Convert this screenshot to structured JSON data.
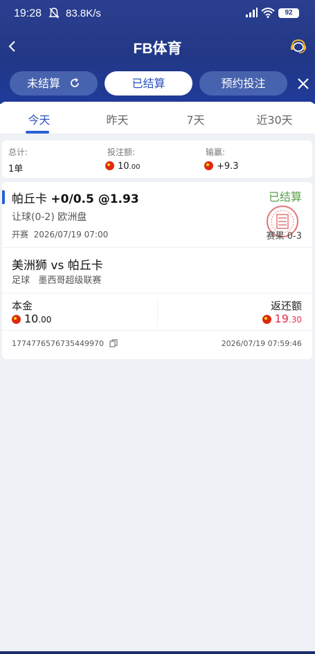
{
  "status_bar": {
    "time": "19:28",
    "net_speed": "83.8K/s",
    "battery": "92"
  },
  "header": {
    "title": "FB体育"
  },
  "filter_tabs": [
    {
      "label": "未结算",
      "active": false
    },
    {
      "label": "已结算",
      "active": true
    },
    {
      "label": "预约投注",
      "active": false
    }
  ],
  "date_tabs": [
    {
      "label": "今天",
      "active": true
    },
    {
      "label": "昨天",
      "active": false
    },
    {
      "label": "7天",
      "active": false
    },
    {
      "label": "近30天",
      "active": false
    }
  ],
  "summary": {
    "total_label": "总计:",
    "total_value": "1单",
    "stake_label": "投注额:",
    "stake_int": "10",
    "stake_dec": ".00",
    "profit_label": "输赢:",
    "profit_value": "+9.3"
  },
  "bet": {
    "team": "帕丘卡",
    "odds_text": "+0/0.5 @1.93",
    "status": "已结算",
    "market": "让球(0-2) 欧洲盘",
    "start_label": "开赛",
    "start_time": "2026/07/19 07:00",
    "result_label": "赛果",
    "result_score": "0-3",
    "match": "美洲狮 vs 帕丘卡",
    "sport": "足球",
    "league": "墨西哥超级联赛",
    "principal_label": "本金",
    "principal_int": "10",
    "principal_dec": ".00",
    "return_label": "返还额",
    "return_int": "19",
    "return_dec": ".30",
    "order_id": "1774776576735449970",
    "order_time": "2026/07/19 07:59:46"
  },
  "colors": {
    "header_bg": "#223886",
    "accent": "#2a4fbf",
    "settled_green": "#58a14a",
    "amount_red": "#e0314b"
  }
}
